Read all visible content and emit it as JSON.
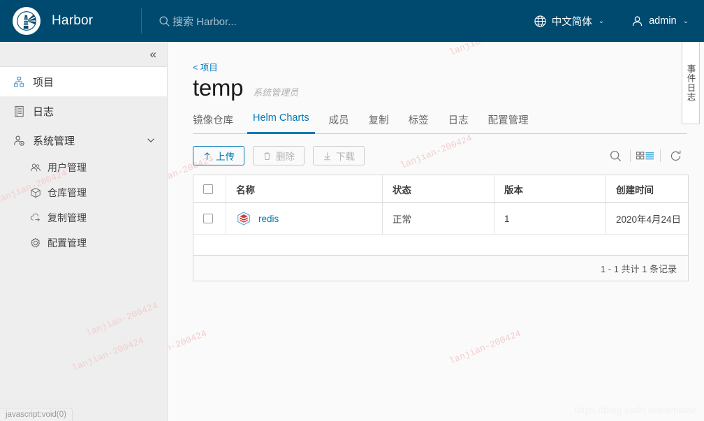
{
  "header": {
    "brand": "Harbor",
    "logo_icon": "harbor-lighthouse-logo",
    "search": {
      "icon": "search-icon",
      "placeholder": "搜索 Harbor..."
    },
    "language": {
      "icon": "globe-icon",
      "label": "中文简体",
      "caret": "⌄"
    },
    "user": {
      "icon": "user-icon",
      "label": "admin",
      "caret": "⌄"
    }
  },
  "sidebar": {
    "collapse_icon": "«",
    "items": [
      {
        "label": "项目",
        "icon": "projects-icon",
        "active": true
      },
      {
        "label": "日志",
        "icon": "logs-icon",
        "active": false
      },
      {
        "label": "系统管理",
        "icon": "system-admin-icon",
        "active": false,
        "expand_icon": "chevron-down-icon"
      }
    ],
    "sub_items": [
      {
        "label": "用户管理",
        "icon": "users-icon"
      },
      {
        "label": "仓库管理",
        "icon": "registry-icon"
      },
      {
        "label": "复制管理",
        "icon": "replication-icon"
      },
      {
        "label": "配置管理",
        "icon": "configuration-icon"
      }
    ]
  },
  "main": {
    "breadcrumb": "< 项目",
    "title": "temp",
    "role": "系统管理员",
    "tabs": [
      {
        "label": "镜像仓库",
        "active": false
      },
      {
        "label": "Helm Charts",
        "active": true
      },
      {
        "label": "成员",
        "active": false
      },
      {
        "label": "复制",
        "active": false
      },
      {
        "label": "标签",
        "active": false
      },
      {
        "label": "日志",
        "active": false
      },
      {
        "label": "配置管理",
        "active": false
      }
    ],
    "toolbar": {
      "upload": {
        "label": "上传",
        "icon": "upload-arrow-icon",
        "disabled": false
      },
      "delete": {
        "label": "删除",
        "icon": "trash-icon",
        "disabled": true
      },
      "download": {
        "label": "下载",
        "icon": "download-arrow-icon",
        "disabled": true
      },
      "search_icon": "search-icon",
      "view_toggle_icon": "grid-list-view-icon",
      "refresh_icon": "refresh-icon"
    },
    "table": {
      "columns": [
        "名称",
        "状态",
        "版本",
        "创建时间"
      ],
      "rows": [
        {
          "name": "redis",
          "icon": "redis-logo-icon",
          "status": "正常",
          "version": "1",
          "created": "2020年4月24日"
        }
      ],
      "footer": "1 - 1 共计 1 条记录"
    },
    "event_log_tab": "事件日志"
  },
  "watermarks": {
    "text": "lanjian-200424",
    "url": "https://blog.csdn.net/arnolan",
    "color": "#f3cdcd"
  },
  "statusbar": {
    "text": "javascript:void(0)"
  },
  "colors": {
    "header_bg": "#004a70",
    "accent": "#0079b8",
    "sidebar_bg": "#eeeeee",
    "content_bg": "#fafafa"
  }
}
